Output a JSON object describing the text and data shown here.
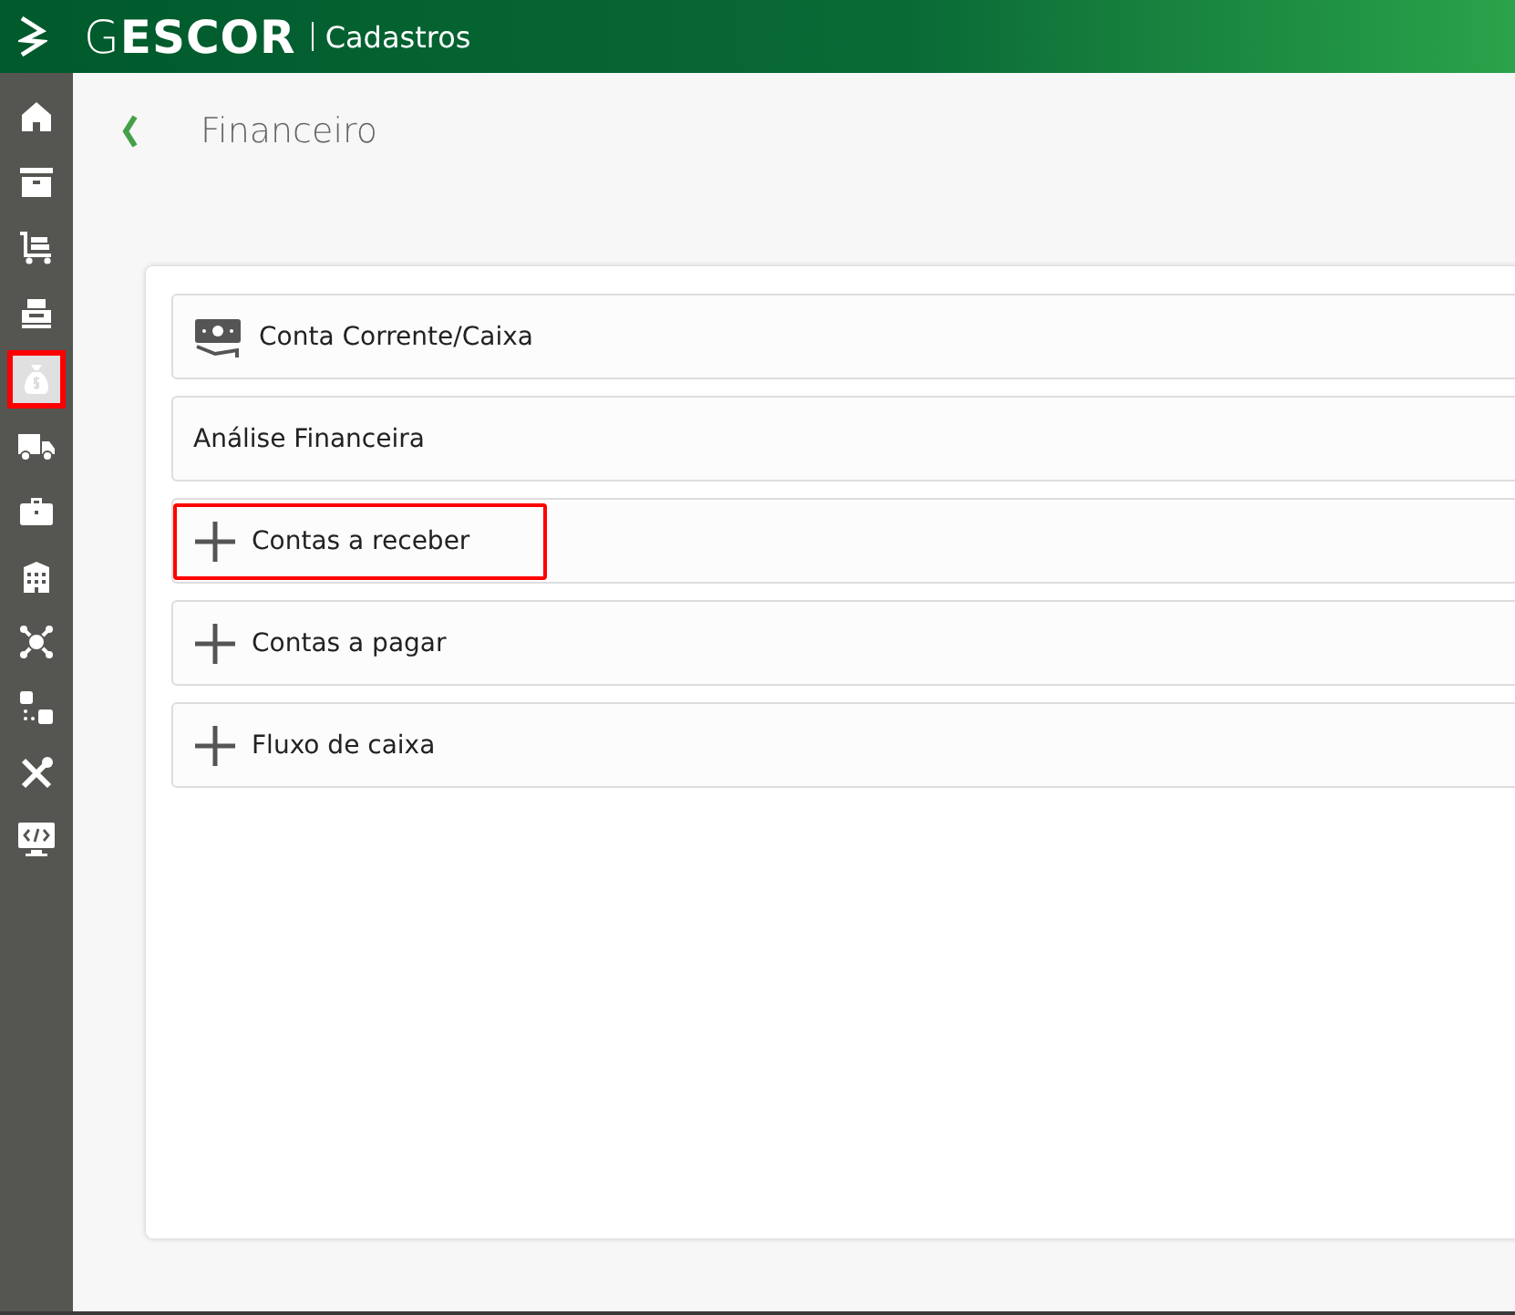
{
  "header": {
    "brand": "G**ESCOR**",
    "section": "Cadastros"
  },
  "sidebar": {
    "items": [
      {
        "kind": "home",
        "selected": false
      },
      {
        "kind": "archive",
        "selected": false
      },
      {
        "kind": "cart",
        "selected": false
      },
      {
        "kind": "register",
        "selected": false
      },
      {
        "kind": "moneybag",
        "selected": true
      },
      {
        "kind": "truck",
        "selected": false
      },
      {
        "kind": "briefcase",
        "selected": false
      },
      {
        "kind": "building",
        "selected": false
      },
      {
        "kind": "network",
        "selected": false
      },
      {
        "kind": "flow",
        "selected": false
      },
      {
        "kind": "tools",
        "selected": false
      },
      {
        "kind": "code",
        "selected": false
      }
    ]
  },
  "page": {
    "title": "Financeiro"
  },
  "items": [
    {
      "kind": "money",
      "label": "Conta Corrente/Caixa",
      "highlighted": false
    },
    {
      "kind": "plain",
      "label": "Análise Financeira",
      "highlighted": false
    },
    {
      "kind": "plus",
      "label": "Contas a receber",
      "highlighted": true
    },
    {
      "kind": "plus",
      "label": "Contas a pagar",
      "highlighted": false
    },
    {
      "kind": "plus",
      "label": "Fluxo de caixa",
      "highlighted": false
    }
  ]
}
